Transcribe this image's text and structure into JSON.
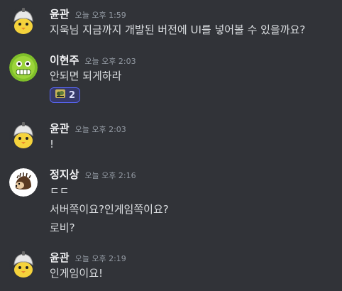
{
  "messages": [
    {
      "username": "윤관",
      "timestamp": "오늘 오후 1:59",
      "lines": [
        "지욱님 지금까지 개발된 버전에 UI를 넣어볼 수 있을까요?"
      ],
      "avatar": "chick-avatar-icon"
    },
    {
      "username": "이현주",
      "timestamp": "오늘 오후 2:03",
      "lines": [
        "안되면 되게하라"
      ],
      "avatar": "green-face-avatar-icon",
      "reaction": {
        "emoji": "sticker-emoji-icon",
        "count": "2"
      }
    },
    {
      "username": "윤관",
      "timestamp": "오늘 오후 2:03",
      "lines": [
        "!"
      ],
      "avatar": "chick-avatar-icon"
    },
    {
      "username": "정지상",
      "timestamp": "오늘 오후 2:16",
      "lines": [
        "ㄷㄷ",
        "서버쪽이요?인게임쪽이요?",
        "로비?"
      ],
      "avatar": "hedgehog-avatar-icon"
    },
    {
      "username": "윤관",
      "timestamp": "오늘 오후 2:19",
      "lines": [
        "인게임이요!"
      ],
      "avatar": "chick-avatar-icon"
    }
  ],
  "colors": {
    "background": "#313338",
    "username": "#f2f3f5",
    "timestamp": "#949ba4",
    "text": "#dbdee1",
    "reaction_border": "#5865f2"
  }
}
